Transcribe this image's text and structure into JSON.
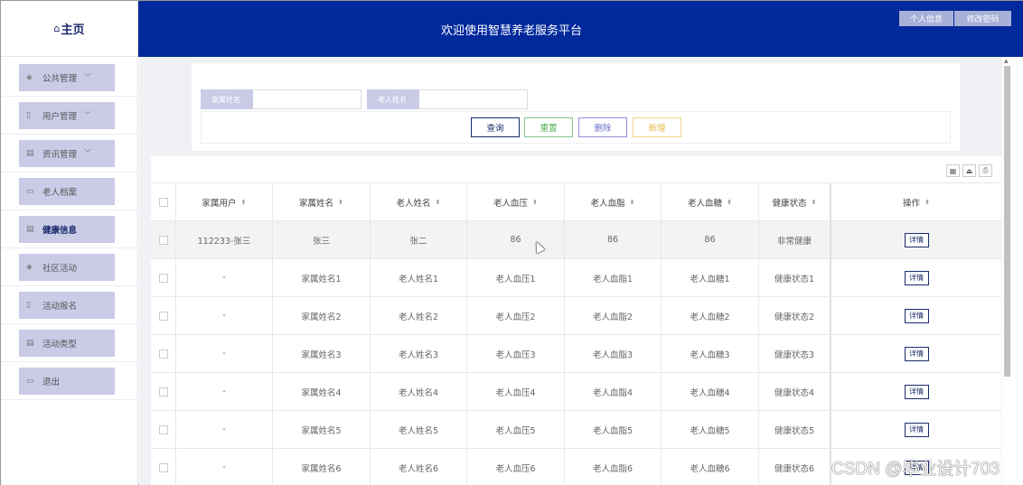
{
  "sidebar": {
    "home_label": "主页",
    "items": [
      {
        "label": "公共管理",
        "icon": "layers-icon",
        "caret": true,
        "active": false
      },
      {
        "label": "用户管理",
        "icon": "doc-icon",
        "caret": true,
        "active": false
      },
      {
        "label": "资讯管理",
        "icon": "list-icon",
        "caret": true,
        "active": false
      },
      {
        "label": "老人档案",
        "icon": "folder-icon",
        "caret": false,
        "active": false
      },
      {
        "label": "健康信息",
        "icon": "list-icon",
        "caret": false,
        "active": true
      },
      {
        "label": "社区活动",
        "icon": "layers-icon",
        "caret": false,
        "active": false
      },
      {
        "label": "活动报名",
        "icon": "doc-icon",
        "caret": false,
        "active": false
      },
      {
        "label": "活动类型",
        "icon": "list-icon",
        "caret": false,
        "active": false
      },
      {
        "label": "退出",
        "icon": "folder-icon",
        "caret": false,
        "active": false
      }
    ]
  },
  "header": {
    "title": "欢迎使用智慧养老服务平台",
    "profile_button": "个人信息",
    "password_button": "修改密码"
  },
  "search": {
    "family_name_label": "家属姓名",
    "family_name_value": "",
    "elder_name_label": "老人姓名",
    "elder_name_value": ""
  },
  "actions": {
    "query": "查询",
    "reset": "重置",
    "delete": "删除",
    "add": "新增"
  },
  "table": {
    "columns": [
      "家属用户",
      "家属姓名",
      "老人姓名",
      "老人血压",
      "老人血脂",
      "老人血糖",
      "健康状态",
      "操作"
    ],
    "detail_label": "详情",
    "rows": [
      [
        "112233-张三",
        "张三",
        "张二",
        "86",
        "86",
        "86",
        "非常健康"
      ],
      [
        "-",
        "家属姓名1",
        "老人姓名1",
        "老人血压1",
        "老人血脂1",
        "老人血糖1",
        "健康状态1"
      ],
      [
        "-",
        "家属姓名2",
        "老人姓名2",
        "老人血压2",
        "老人血脂2",
        "老人血糖2",
        "健康状态2"
      ],
      [
        "-",
        "家属姓名3",
        "老人姓名3",
        "老人血压3",
        "老人血脂3",
        "老人血糖3",
        "健康状态3"
      ],
      [
        "-",
        "家属姓名4",
        "老人姓名4",
        "老人血压4",
        "老人血脂4",
        "老人血糖4",
        "健康状态4"
      ],
      [
        "-",
        "家属姓名5",
        "老人姓名5",
        "老人血压5",
        "老人血脂5",
        "老人血糖5",
        "健康状态5"
      ],
      [
        "-",
        "家属姓名6",
        "老人姓名6",
        "老人血压6",
        "老人血脂6",
        "老人血糖6",
        "健康状态6"
      ]
    ]
  },
  "watermark": "CSDN @毕业设计703",
  "colors": {
    "header_bg": "#00299c",
    "menu_bg": "#c9cbe7",
    "brand_dark": "#1b2b6a"
  }
}
